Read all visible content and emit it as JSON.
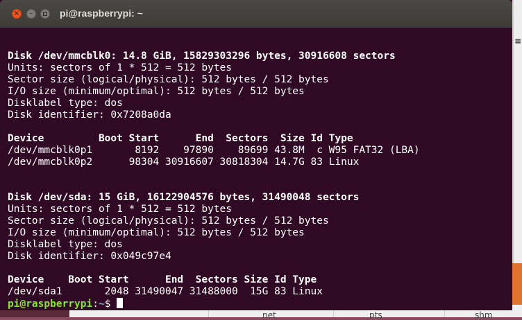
{
  "window": {
    "title": "pi@raspberrypi: ~",
    "close_icon": "×",
    "min_icon": "–"
  },
  "terminal": {
    "lines": [
      {
        "text": "",
        "bold": false
      },
      {
        "text": "Disk /dev/mmcblk0: 14.8 GiB, 15829303296 bytes, 30916608 sectors",
        "bold": true
      },
      {
        "text": "Units: sectors of 1 * 512 = 512 bytes",
        "bold": false
      },
      {
        "text": "Sector size (logical/physical): 512 bytes / 512 bytes",
        "bold": false
      },
      {
        "text": "I/O size (minimum/optimal): 512 bytes / 512 bytes",
        "bold": false
      },
      {
        "text": "Disklabel type: dos",
        "bold": false
      },
      {
        "text": "Disk identifier: 0x7208a0da",
        "bold": false
      },
      {
        "text": "",
        "bold": false
      },
      {
        "text": "Device         Boot Start      End  Sectors  Size Id Type",
        "bold": true
      },
      {
        "text": "/dev/mmcblk0p1       8192    97890    89699 43.8M  c W95 FAT32 (LBA)",
        "bold": false
      },
      {
        "text": "/dev/mmcblk0p2      98304 30916607 30818304 14.7G 83 Linux",
        "bold": false
      },
      {
        "text": "",
        "bold": false
      },
      {
        "text": "",
        "bold": false
      },
      {
        "text": "Disk /dev/sda: 15 GiB, 16122904576 bytes, 31490048 sectors",
        "bold": true
      },
      {
        "text": "Units: sectors of 1 * 512 = 512 bytes",
        "bold": false
      },
      {
        "text": "Sector size (logical/physical): 512 bytes / 512 bytes",
        "bold": false
      },
      {
        "text": "I/O size (minimum/optimal): 512 bytes / 512 bytes",
        "bold": false
      },
      {
        "text": "Disklabel type: dos",
        "bold": false
      },
      {
        "text": "Disk identifier: 0x049c97e4",
        "bold": false
      },
      {
        "text": "",
        "bold": false
      },
      {
        "text": "Device    Boot Start      End  Sectors Size Id Type",
        "bold": true
      },
      {
        "text": "/dev/sda1       2048 31490047 31488000  15G 83 Linux",
        "bold": false
      }
    ],
    "prompt": {
      "user_host": "pi@raspberrypi",
      "separator": ":",
      "path": "~",
      "symbol": "$ "
    }
  },
  "desktop": {
    "right_glyph": "≡",
    "bottom_items": [
      "net",
      "pts",
      "shm"
    ]
  },
  "colors": {
    "terminal_bg": "#300a24",
    "prompt_user": "#8ae234",
    "prompt_path": "#729fcf",
    "close_button": "#e9541f"
  }
}
